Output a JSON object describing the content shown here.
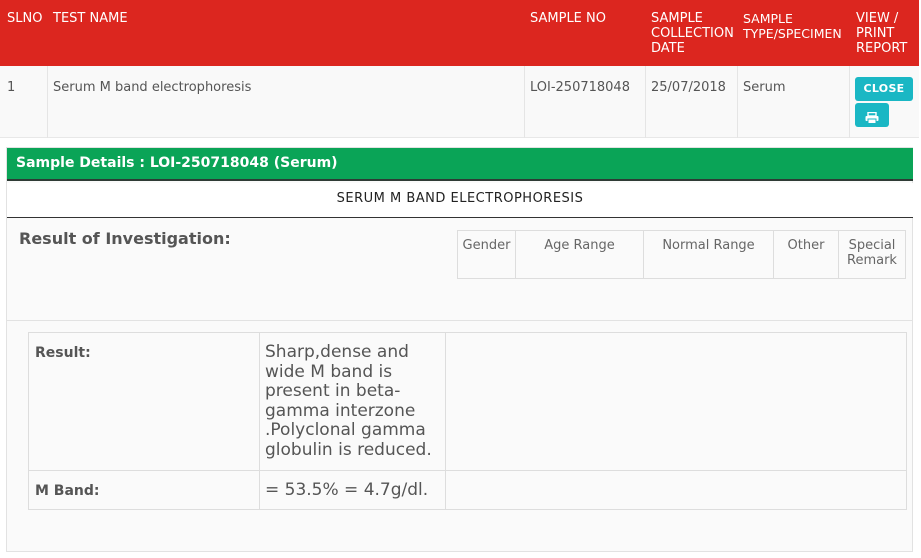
{
  "table": {
    "headers": {
      "slno": "SLNO",
      "test_name": "TEST NAME",
      "sample_no": "SAMPLE NO",
      "sample_collection_date": "SAMPLE COLLECTION DATE",
      "sample_type": "SAMPLE TYPE/SPECIMEN",
      "view_print": "VIEW / PRINT REPORT"
    },
    "row": {
      "slno": "1",
      "test_name": "Serum M band electrophoresis",
      "sample_no": "LOI-250718048",
      "date": "25/07/2018",
      "type": "Serum",
      "close_label": "CLOSE"
    }
  },
  "details": {
    "title": "Sample Details : LOI-250718048 (Serum)",
    "test_heading": "SERUM M BAND ELECTROPHORESIS",
    "investigation_label": "Result of Investigation:",
    "ref_headers": {
      "gender": "Gender",
      "age_range": "Age Range",
      "normal_range": "Normal Range",
      "other": "Other",
      "special_remark": "Special Remark"
    },
    "results": [
      {
        "label": "Result:",
        "value": "Sharp,dense and wide M band is present in beta-gamma interzone .Polyclonal gamma globulin is reduced."
      },
      {
        "label": "M Band:",
        "value": "= 53.5% = 4.7g/dl."
      }
    ]
  },
  "colors": {
    "header_red": "#dc261f",
    "panel_green": "#0aa457",
    "button_teal": "#1ab7c4"
  },
  "icons": {
    "print": "printer-icon"
  }
}
